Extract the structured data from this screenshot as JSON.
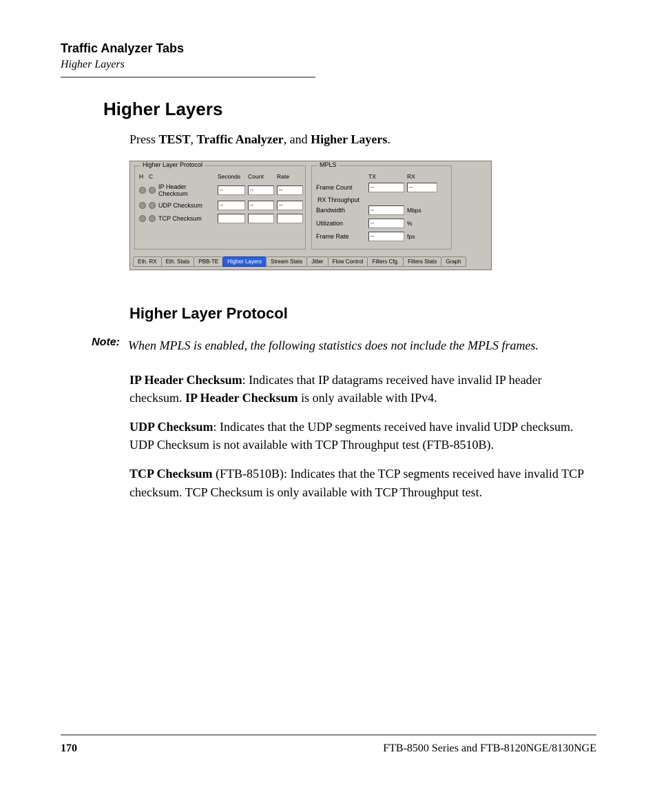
{
  "header": {
    "chapter": "Traffic Analyzer Tabs",
    "section": "Higher Layers"
  },
  "title": "Higher Layers",
  "intro_pre": "Press ",
  "intro_b1": "TEST",
  "intro_mid1": ", ",
  "intro_b2": "Traffic Analyzer",
  "intro_mid2": ", and ",
  "intro_b3": "Higher Layers",
  "intro_post": ".",
  "subheading": "Higher Layer Protocol",
  "note_label": "Note:",
  "note_text": "When MPLS is enabled, the following statistics does not include the MPLS frames.",
  "p1_b": "IP Header Checksum",
  "p1_a": ": Indicates that IP datagrams received have have invalid IP header checksum. ",
  "p1_b2": "IP Header Checksum",
  "p1_c": " is only available with IPv4.",
  "p1_full_a": ": Indicates that IP datagrams received have invalid IP header checksum. ",
  "p2_b": "UDP Checksum",
  "p2_text": ": Indicates that the UDP segments received have invalid UDP checksum. UDP Checksum is not available with TCP Throughput test (FTB-8510B).",
  "p3_b": "TCP Checksum",
  "p3_text": " (FTB-8510B): Indicates that the TCP segments received have invalid TCP checksum. TCP Checksum is only available with TCP Throughput test.",
  "footer": {
    "page": "170",
    "product": "FTB-8500 Series and FTB-8120NGE/8130NGE"
  },
  "shot": {
    "hlp_legend": "Higher Layer Protocol",
    "mpls_legend": "MPLS",
    "col_h": "H",
    "col_c": "C",
    "col_seconds": "Seconds",
    "col_count": "Count",
    "col_rate": "Rate",
    "rows": [
      {
        "name": "IP Header Checksum",
        "seconds": "--",
        "count": "--",
        "rate": "--"
      },
      {
        "name": "UDP Checksum",
        "seconds": "--",
        "count": "--",
        "rate": "--"
      },
      {
        "name": "TCP Checksum",
        "seconds": "",
        "count": "",
        "rate": ""
      }
    ],
    "mpls_tx": "TX",
    "mpls_rx": "RX",
    "mpls_frame_count": "Frame Count",
    "fc_tx": "--",
    "fc_rx": "--",
    "rx_throughput": "RX Throughput",
    "bw_label": "Bandwidth",
    "bw_val": "--",
    "bw_unit": "Mbps",
    "ut_label": "Utilization",
    "ut_val": "--",
    "ut_unit": "%",
    "fr_label": "Frame Rate",
    "fr_val": "--",
    "fr_unit": "fps",
    "tabs": [
      "Eth. RX",
      "Eth. Stats",
      "PBB-TE",
      "Higher Layers",
      "Stream Stats",
      "Jitter",
      "Flow Control",
      "Filters Cfg.",
      "Filters Stats",
      "Graph"
    ]
  }
}
